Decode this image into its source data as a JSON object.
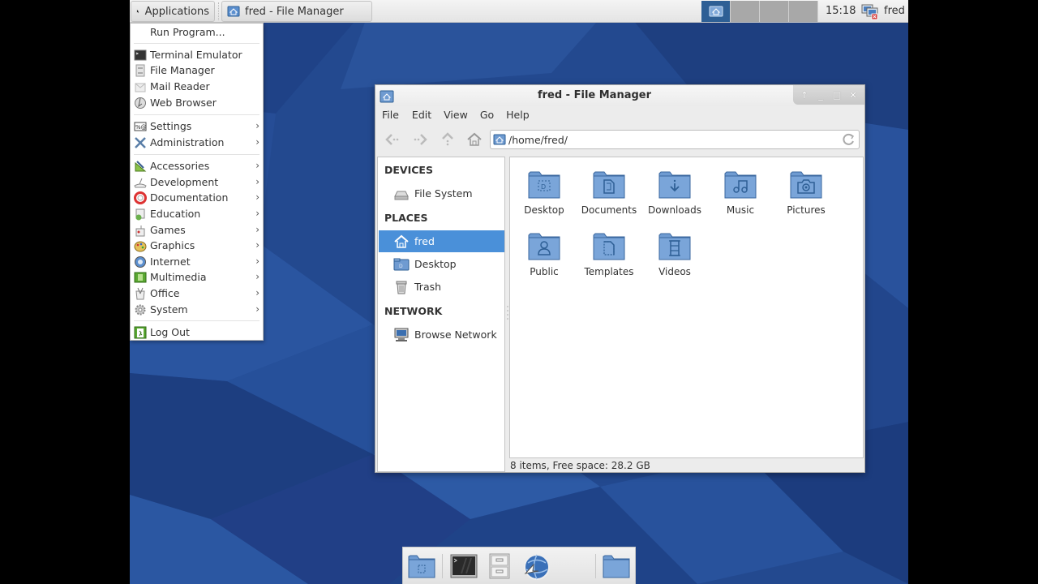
{
  "colors": {
    "desktop_bg": "#23498f",
    "accent_selected": "#4a90d9",
    "folder_blue": "#6f9bd1",
    "active_workspace": "#2e5f95"
  },
  "top_panel": {
    "applications_label": "Applications",
    "task_label": "fred - File Manager",
    "workspaces": [
      "1",
      "2",
      "3",
      "4"
    ],
    "active_workspace": 1,
    "clock": "15:18",
    "network_icon": "network-disconnected-icon",
    "user": "fred"
  },
  "app_menu": {
    "items": [
      {
        "label": "Run Program...",
        "icon": "",
        "submenu": false
      },
      {
        "label": "Terminal Emulator",
        "icon": "terminal-icon",
        "submenu": false
      },
      {
        "label": "File Manager",
        "icon": "file-manager-icon",
        "submenu": false
      },
      {
        "label": "Mail Reader",
        "icon": "mail-icon",
        "submenu": false
      },
      {
        "label": "Web Browser",
        "icon": "web-browser-icon",
        "submenu": false
      },
      {
        "label": "Settings",
        "icon": "settings-icon",
        "submenu": true
      },
      {
        "label": "Administration",
        "icon": "administration-icon",
        "submenu": true
      },
      {
        "label": "Accessories",
        "icon": "accessories-icon",
        "submenu": true
      },
      {
        "label": "Development",
        "icon": "development-icon",
        "submenu": true
      },
      {
        "label": "Documentation",
        "icon": "documentation-icon",
        "submenu": true
      },
      {
        "label": "Education",
        "icon": "education-icon",
        "submenu": true
      },
      {
        "label": "Games",
        "icon": "games-icon",
        "submenu": true
      },
      {
        "label": "Graphics",
        "icon": "graphics-icon",
        "submenu": true
      },
      {
        "label": "Internet",
        "icon": "internet-icon",
        "submenu": true
      },
      {
        "label": "Multimedia",
        "icon": "multimedia-icon",
        "submenu": true
      },
      {
        "label": "Office",
        "icon": "office-icon",
        "submenu": true
      },
      {
        "label": "System",
        "icon": "system-icon",
        "submenu": true
      },
      {
        "label": "Log Out",
        "icon": "log-out-icon",
        "submenu": false
      }
    ],
    "submenu_arrow": "›"
  },
  "file_manager": {
    "title": "fred - File Manager",
    "window_controls": [
      "↑",
      "_",
      "□",
      "✕"
    ],
    "menubar": [
      "File",
      "Edit",
      "View",
      "Go",
      "Help"
    ],
    "location": "/home/fred/",
    "sidepane": {
      "devices_header": "DEVICES",
      "devices": [
        {
          "label": "File System",
          "icon": "drive-icon"
        }
      ],
      "places_header": "PLACES",
      "places": [
        {
          "label": "fred",
          "icon": "home-icon",
          "selected": true
        },
        {
          "label": "Desktop",
          "icon": "desktop-folder-icon",
          "selected": false
        },
        {
          "label": "Trash",
          "icon": "trash-icon",
          "selected": false
        }
      ],
      "network_header": "NETWORK",
      "network": [
        {
          "label": "Browse Network",
          "icon": "network-icon"
        }
      ]
    },
    "folders": [
      {
        "label": "Desktop",
        "icon": "desktop"
      },
      {
        "label": "Documents",
        "icon": "documents"
      },
      {
        "label": "Downloads",
        "icon": "downloads"
      },
      {
        "label": "Music",
        "icon": "music"
      },
      {
        "label": "Pictures",
        "icon": "pictures"
      },
      {
        "label": "Public",
        "icon": "public"
      },
      {
        "label": "Templates",
        "icon": "templates"
      },
      {
        "label": "Videos",
        "icon": "videos"
      }
    ],
    "status": "8 items, Free space: 28.2 GB"
  },
  "dock": {
    "items": [
      "home-folder-icon",
      "terminal-icon",
      "file-cabinet-icon",
      "web-browser-icon",
      "folder-icon"
    ]
  }
}
